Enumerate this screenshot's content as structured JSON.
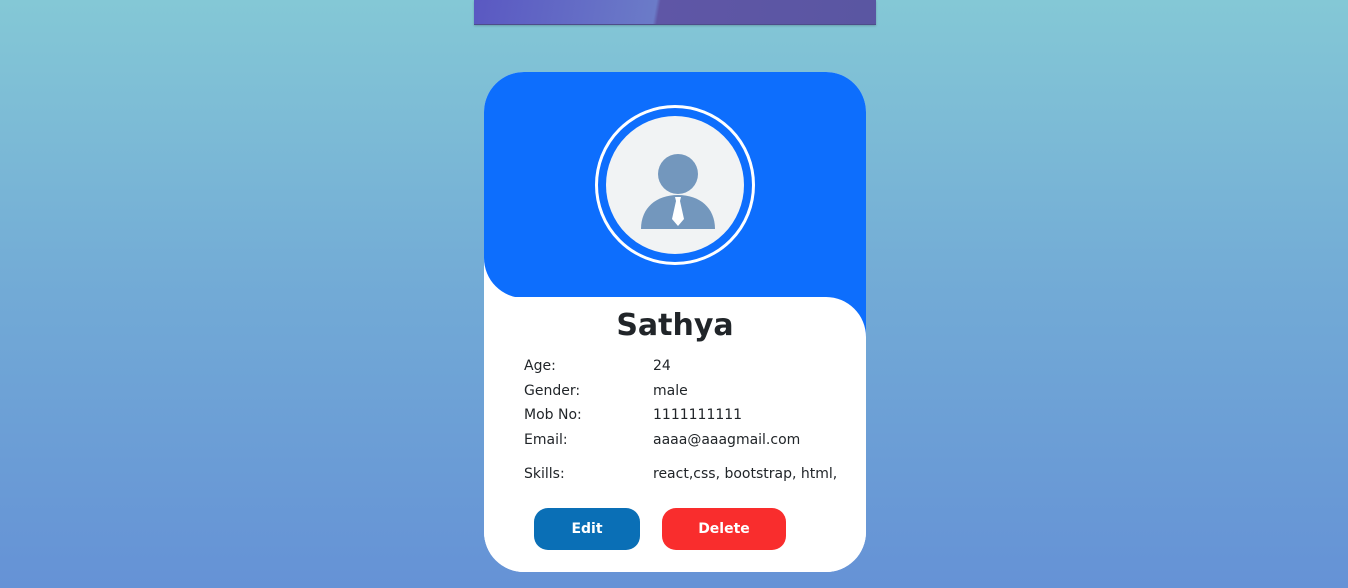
{
  "profile": {
    "name": "Sathya",
    "fields": [
      {
        "label": "Age:",
        "value": "24"
      },
      {
        "label": "Gender:",
        "value": "male"
      },
      {
        "label": "Mob No:",
        "value": "1111111111"
      },
      {
        "label": "Email:",
        "value": "aaaa@aaagmail.com"
      },
      {
        "label": "Skills:",
        "value": "react,css, bootstrap, html,"
      }
    ],
    "avatar_icon": "user-tie-icon"
  },
  "actions": {
    "edit_label": "Edit",
    "delete_label": "Delete"
  },
  "colors": {
    "header_blue": "#0d6efd",
    "edit_button": "#0a6fb6",
    "delete_button": "#f92d2d",
    "avatar_figure": "#7397bd"
  }
}
